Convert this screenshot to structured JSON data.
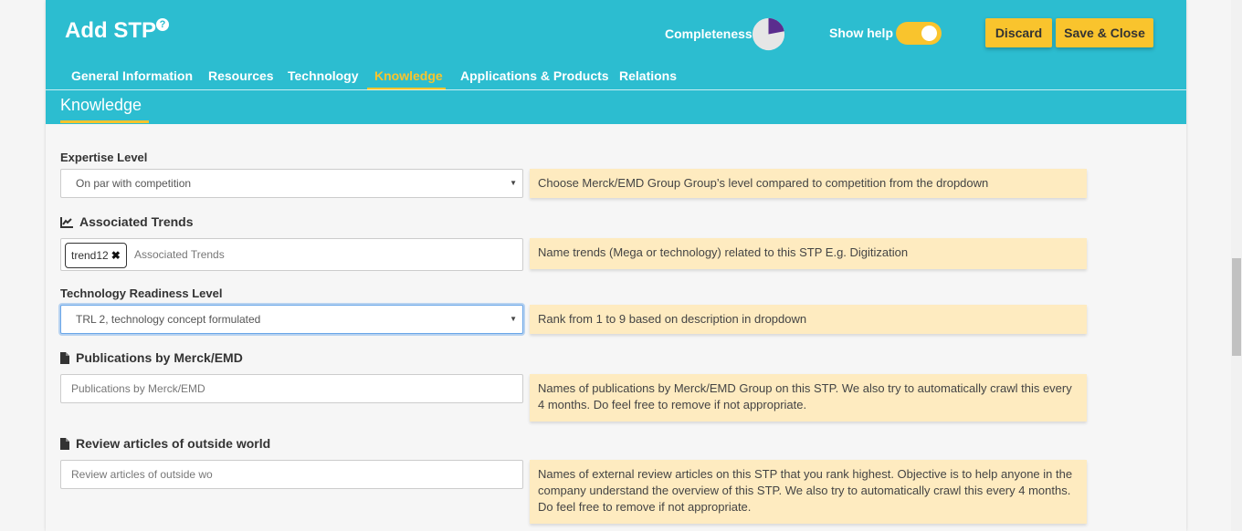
{
  "header": {
    "title": "Add STP",
    "help_icon": "?",
    "completeness_label": "Completeness",
    "completeness_fraction": 0.22,
    "show_help_label": "Show help",
    "show_help_on": true,
    "discard_label": "Discard",
    "save_label": "Save & Close"
  },
  "tabs": [
    {
      "label": "General Information",
      "active": false
    },
    {
      "label": "Resources",
      "active": false
    },
    {
      "label": "Technology",
      "active": false
    },
    {
      "label": "Knowledge",
      "active": true
    },
    {
      "label": "Applications & Products",
      "active": false
    },
    {
      "label": "Relations",
      "active": false
    }
  ],
  "section": {
    "title": "Knowledge"
  },
  "form": {
    "expertise": {
      "label": "Expertise Level",
      "value": "On par with competition",
      "help": "Choose Merck/EMD Group Group’s level compared to competition from the dropdown"
    },
    "trends": {
      "label": "Associated Trends",
      "icon": "chart-line-icon",
      "chip": "trend12",
      "chip_remove": "✖",
      "placeholder": "Associated Trends",
      "help": "Name trends (Mega or technology) related to this STP E.g. Digitization"
    },
    "trl": {
      "label": "Technology Readiness Level",
      "value": "TRL 2, technology concept formulated",
      "help": "Rank from 1 to 9 based on description in dropdown"
    },
    "publications": {
      "label": "Publications by Merck/EMD",
      "icon": "document-icon",
      "placeholder": "Publications by Merck/EMD",
      "help": "Names of publications by Merck/EMD Group on this STP. We also try to automatically crawl this every 4 months. Do feel free to remove if not appropriate."
    },
    "reviews": {
      "label": "Review articles of outside world",
      "icon": "document-icon",
      "placeholder": "Review articles of outside wo",
      "help": "Names of external review articles on this STP that you rank highest. Objective is to help anyone in the company understand the overview of this STP. We also try to automatically crawl this every 4 months. Do feel free to remove if not appropriate."
    }
  },
  "colors": {
    "header_bg": "#2cbdd0",
    "accent": "#f9c42d",
    "help_bg": "#feebc0",
    "completeness_fill": "#5b2d8e"
  }
}
